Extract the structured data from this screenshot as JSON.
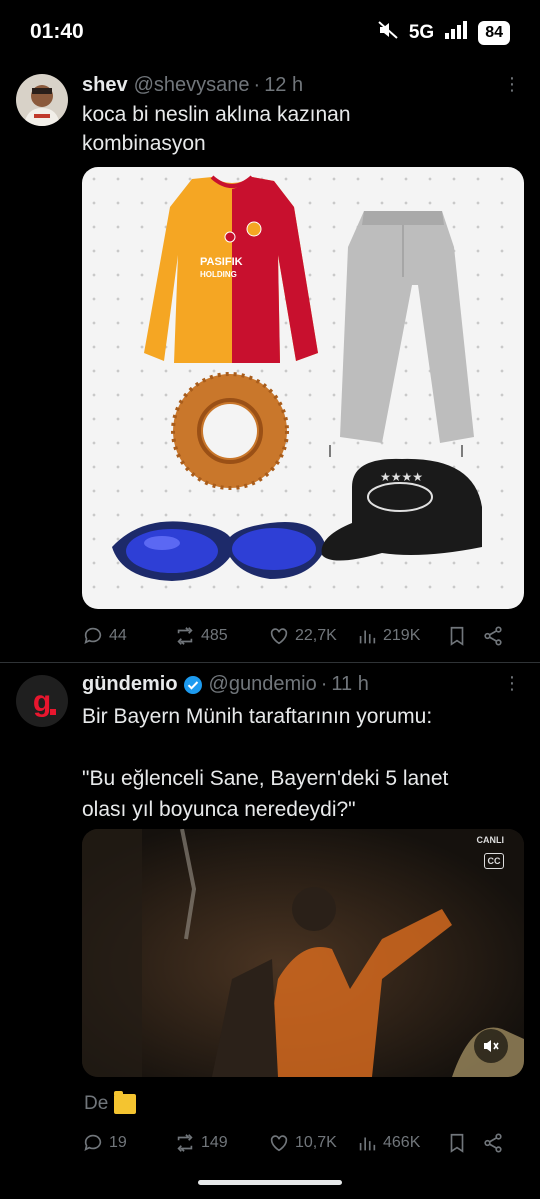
{
  "status_bar": {
    "time": "01:40",
    "network": "5G",
    "battery": "84"
  },
  "tweets": [
    {
      "name": "shev",
      "handle": "@shevysane",
      "dot": "·",
      "time": "12 h",
      "text": "koca bi neslin aklına kazınan\nkombinasyon",
      "media": {
        "items": [
          "galatasaray-jersey",
          "grey-sweatpants",
          "simit",
          "blue-sunglasses",
          "black-trucker-cap"
        ],
        "jersey_sponsor": "PASIFIK\nHOLDING"
      },
      "stats": {
        "replies": "44",
        "reposts": "485",
        "likes": "22,7K",
        "views": "219K"
      }
    },
    {
      "name": "gündemio",
      "handle": "@gundemio",
      "dot": "·",
      "time": "11 h",
      "verified": true,
      "text": "Bir Bayern Münih taraftarının yorumu:\n\n\"Bu eğlenceli Sane, Bayern'deki 5 lanet\nolası yıl boyunca neredeydi?\"",
      "media": {
        "type": "video",
        "live_label": "CANLI",
        "cc_label": "CC"
      },
      "trailing_text": "De",
      "stats": {
        "replies": "19",
        "reposts": "149",
        "likes": "10,7K",
        "views": "466K"
      }
    }
  ],
  "colors": {
    "background": "#000000",
    "text": "#e7e9ea",
    "muted": "#71767b",
    "verified": "#1d9bf0",
    "divider": "#2f3336"
  }
}
